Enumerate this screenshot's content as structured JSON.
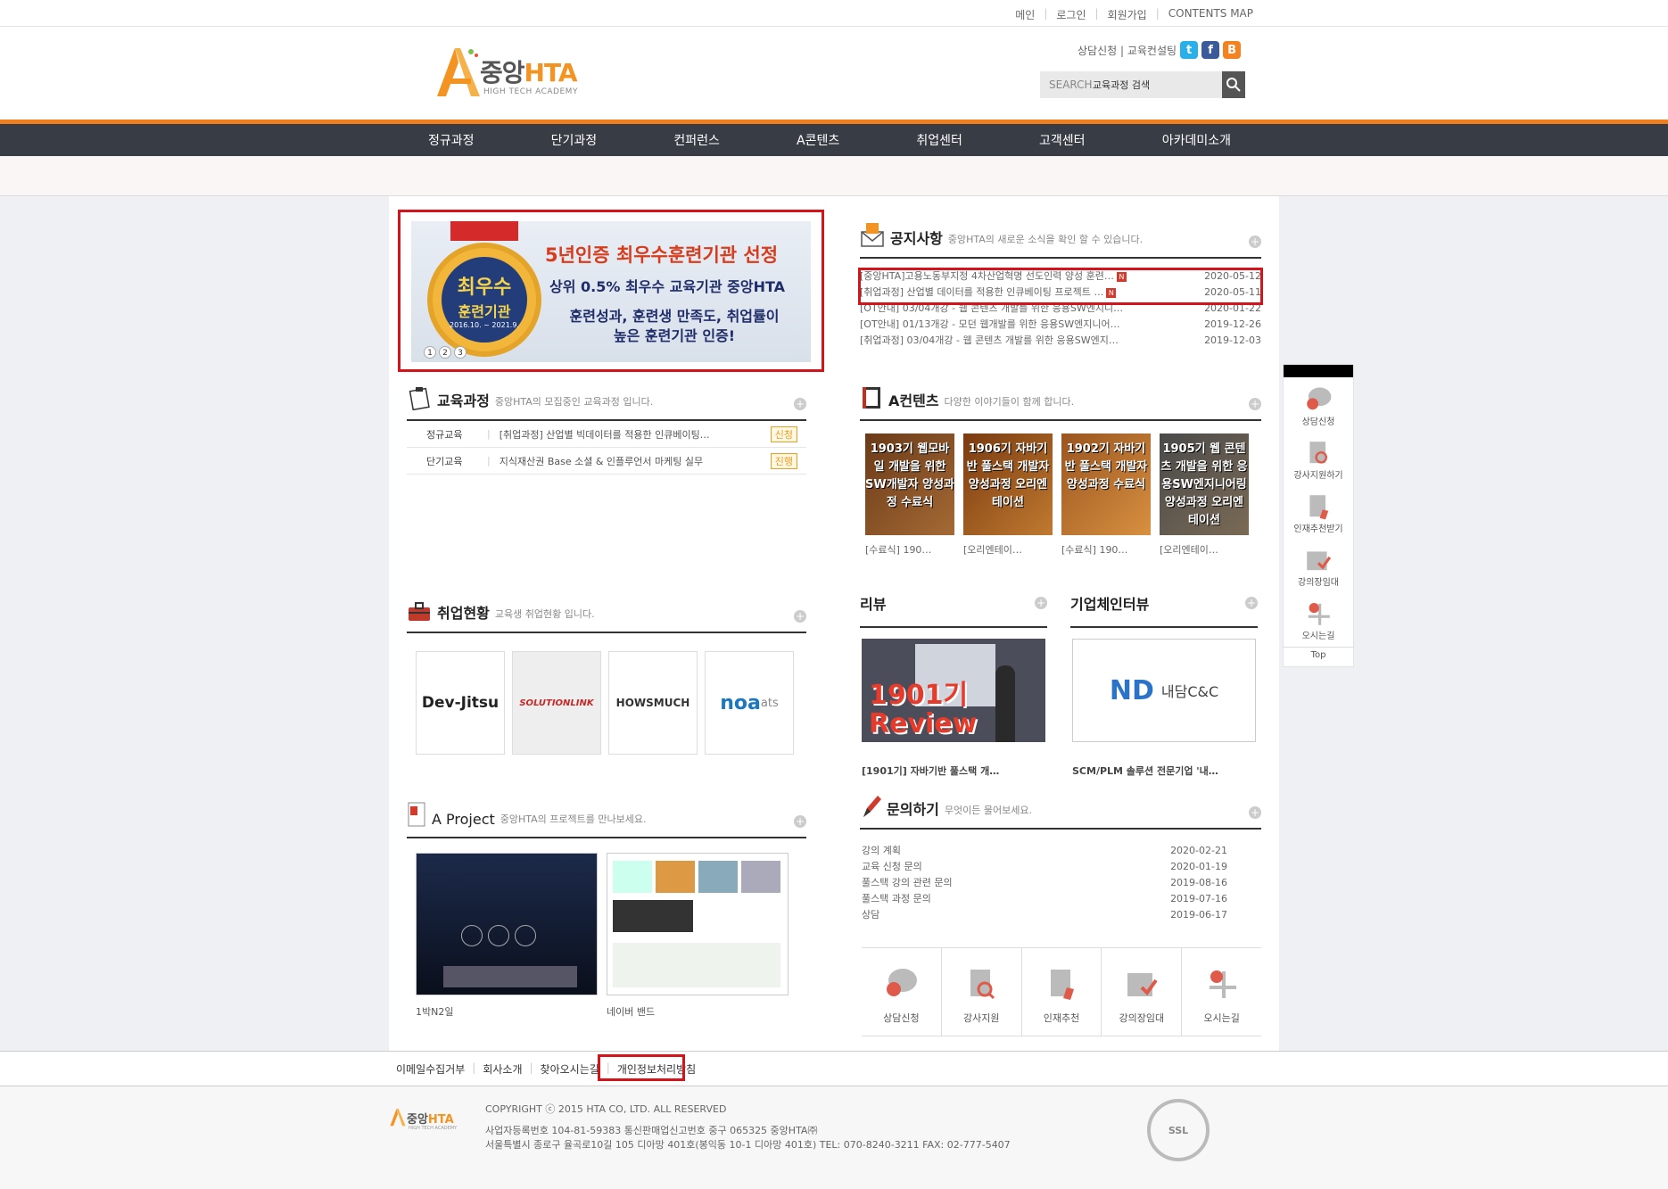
{
  "util": {
    "items": [
      "메인",
      "로그인",
      "회원가입",
      "CONTENTS MAP"
    ]
  },
  "logo": {
    "main": "중앙",
    "accent": "HTA",
    "sub": "HIGH TECH ACADEMY"
  },
  "consult": {
    "text": "상담신청 | 교육컨설팅",
    "sns": [
      "t",
      "f",
      "B"
    ]
  },
  "search": {
    "label": "SEARCH",
    "value": "교육과정 검색"
  },
  "nav": {
    "items": [
      "정규과정",
      "단기과정",
      "컨퍼런스",
      "A콘텐츠",
      "취업센터",
      "고객센터",
      "아카데미소개"
    ]
  },
  "banner": {
    "ribbon": "",
    "medal_l1": "최우수",
    "medal_l2": "훈련기관",
    "medal_l3": "2016.10. ~ 2021.9.",
    "line1": "5년인증 최우수훈련기관 선정",
    "line2": "상위 0.5% 최우수 교육기관 중앙HTA",
    "line3": "훈련성과, 훈련생 만족도, 취업률이",
    "line4": "높은 훈련기관 인증!",
    "dots": [
      "1",
      "2",
      "3"
    ]
  },
  "notice": {
    "title": "공지사항",
    "sub": "중앙HTA의 새로운 소식을 확인 할 수 있습니다.",
    "rows": [
      {
        "title": "[중앙HTA]고용노동부지정 4차산업혁명 선도인력 양성 훈련…",
        "new": "N",
        "date": "2020-05-12"
      },
      {
        "title": "[취업과정] 산업별 데이터를 적용한 인큐베이팅 프로젝트 …",
        "new": "N",
        "date": "2020-05-11"
      },
      {
        "title": "[OT안내] 03/04개강 - 웹 콘텐츠 개발를 위한 응용SW엔지니…",
        "new": "",
        "date": "2020-01-22"
      },
      {
        "title": "[OT안내] 01/13개강 - 모던 웹개발를 위한 응용SW엔지니어…",
        "new": "",
        "date": "2019-12-26"
      },
      {
        "title": "[취업과정] 03/04개강 - 웹 콘텐츠 개발를 위한 응용SW엔지…",
        "new": "",
        "date": "2019-12-03"
      }
    ]
  },
  "edu": {
    "title": "교육과정",
    "sub": "중앙HTA의 모집중인 교육과정 입니다.",
    "rows": [
      {
        "cat": "정규교육",
        "title": "[취업과정] 산업별 빅데이터를 적용한 인큐베이팅…",
        "tag": "신청"
      },
      {
        "cat": "단기교육",
        "title": "지식재산권 Base 소셜 & 인플루언서 마케팅 실무",
        "tag": "진행"
      }
    ]
  },
  "acon": {
    "title": "A컨텐츠",
    "sub": "다양한 이야기들이 함께 합니다.",
    "items": [
      {
        "art": "1903기 웹모바일 개발을 위한 SW개발자 양성과정 수료식",
        "cap": "[수료식] 190…",
        "bg": "#7a4a25"
      },
      {
        "art": "1906기 자바기반 풀스택 개발자 양성과정 오리엔테이션",
        "cap": "[오리엔테이…",
        "bg": "#8a4b1c"
      },
      {
        "art": "1902기 자바기반 풀스택 개발자 양성과정 수료식",
        "cap": "[수료식] 190…",
        "bg": "#b06a2a"
      },
      {
        "art": "1905기 웹 콘텐츠 개발을 위한 응용SW엔지니어링 양성과정 오리엔테이션",
        "cap": "[오리엔테이…",
        "bg": "#5b5a58"
      }
    ]
  },
  "review": {
    "title": "리뷰",
    "img_text": "1901기 Review",
    "cap": "[1901기] 자바기반 풀스택 개…"
  },
  "interview": {
    "title": "기업체인터뷰",
    "logo": "ND",
    "logo_text": "내담C&C",
    "cap": "SCM/PLM 솔루션 전문기업 '내…"
  },
  "emp": {
    "title": "취업현황",
    "sub": "교육생 취업현황 입니다.",
    "logos": [
      "Dev-Jitsu",
      "SOLUTIONLINK",
      "HOWSMUCH",
      "noa"
    ],
    "noa_sup": "ats"
  },
  "proj": {
    "title": "A Project",
    "sub": "중앙HTA의 프로젝트를 만나보세요.",
    "items": [
      {
        "cap": "1박N2일"
      },
      {
        "cap": "네이버 밴드"
      }
    ]
  },
  "inq": {
    "title": "문의하기",
    "sub": "무엇이든 물어보세요.",
    "rows": [
      {
        "title": "강의 계획",
        "date": "2020-02-21"
      },
      {
        "title": "교육 신청 문의",
        "date": "2020-01-19"
      },
      {
        "title": "풀스택 강의 관련 문의",
        "date": "2019-08-16"
      },
      {
        "title": "풀스택 과정 문의",
        "date": "2019-07-16"
      },
      {
        "title": "상담",
        "date": "2019-06-17"
      }
    ]
  },
  "quick": {
    "items": [
      "상담신청",
      "강사지원",
      "인재추천",
      "강의장임대",
      "오시는길"
    ]
  },
  "side": {
    "items": [
      "상담신청",
      "강사지원하기",
      "인재추천받기",
      "강의장임대",
      "오시는길"
    ],
    "top": "Top"
  },
  "footnav": {
    "items": [
      "이메일수집거부",
      "회사소개",
      "찾아오시는길",
      "개인정보처리방침"
    ]
  },
  "footer": {
    "copy": "COPYRIGHT ⓒ 2015 HTA CO, LTD. ALL RESERVED",
    "line2": "사업자등록번호 104-81-59383 통신판매업신고번호 중구 065325 중앙HTA㈜",
    "line3": "서울특별시 종로구 율곡로10길 105 디아망 401호(봉익동 10-1 디아망 401호) TEL: 070-8240-3211 FAX: 02-777-5407",
    "ssl": "SSL"
  },
  "colors": {
    "accent": "#f07e1c",
    "nav": "#383c44",
    "red": "#d3141b"
  }
}
